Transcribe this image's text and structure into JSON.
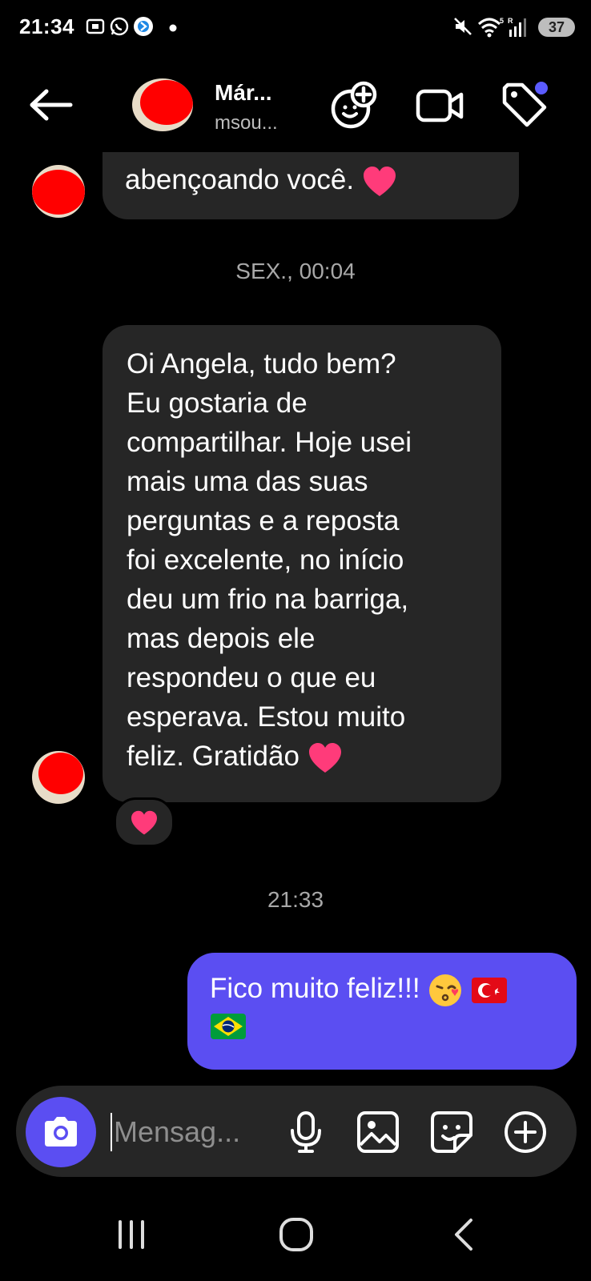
{
  "status_bar": {
    "time": "21:34",
    "battery": "37",
    "icons": [
      "screenshot-icon",
      "whatsapp-icon",
      "app-notification-icon",
      "dot-icon",
      "mute-icon",
      "wifi-icon",
      "signal-icon",
      "battery-icon"
    ]
  },
  "header": {
    "name": "Már...",
    "username": "msou...",
    "icons": [
      "back-arrow-icon",
      "add-effect-icon",
      "video-call-icon",
      "tag-icon"
    ],
    "notification_dot_color": "#5b5bff"
  },
  "messages": [
    {
      "type": "incoming",
      "text": "abençoando você.",
      "emoji": "heart"
    },
    {
      "type": "timestamp",
      "text": "SEX., 00:04"
    },
    {
      "type": "incoming",
      "lines": [
        "Oi Angela, tudo bem?",
        "Eu gostaria de",
        "compartilhar. Hoje usei",
        "mais uma das suas",
        "perguntas e a reposta",
        "foi excelente, no início",
        "deu um frio na barriga,",
        "mas depois ele",
        "respondeu o que eu",
        "esperava. Estou muito",
        "feliz. Gratidão"
      ],
      "emoji": "heart",
      "reaction": "heart"
    },
    {
      "type": "timestamp",
      "text": "21:33"
    },
    {
      "type": "outgoing",
      "text": "Fico muito feliz!!!",
      "emojis": [
        "kissing-face",
        "turkey-flag",
        "brazil-flag"
      ]
    }
  ],
  "composer": {
    "placeholder": "Mensag...",
    "icons": [
      "camera-icon",
      "microphone-icon",
      "gallery-icon",
      "sticker-icon",
      "plus-circle-icon"
    ]
  },
  "nav_bar": {
    "icons": [
      "recent-apps-icon",
      "home-icon",
      "back-icon"
    ]
  },
  "colors": {
    "accent": "#5b4ef2",
    "incoming_bubble": "#262626",
    "background": "#000000"
  }
}
